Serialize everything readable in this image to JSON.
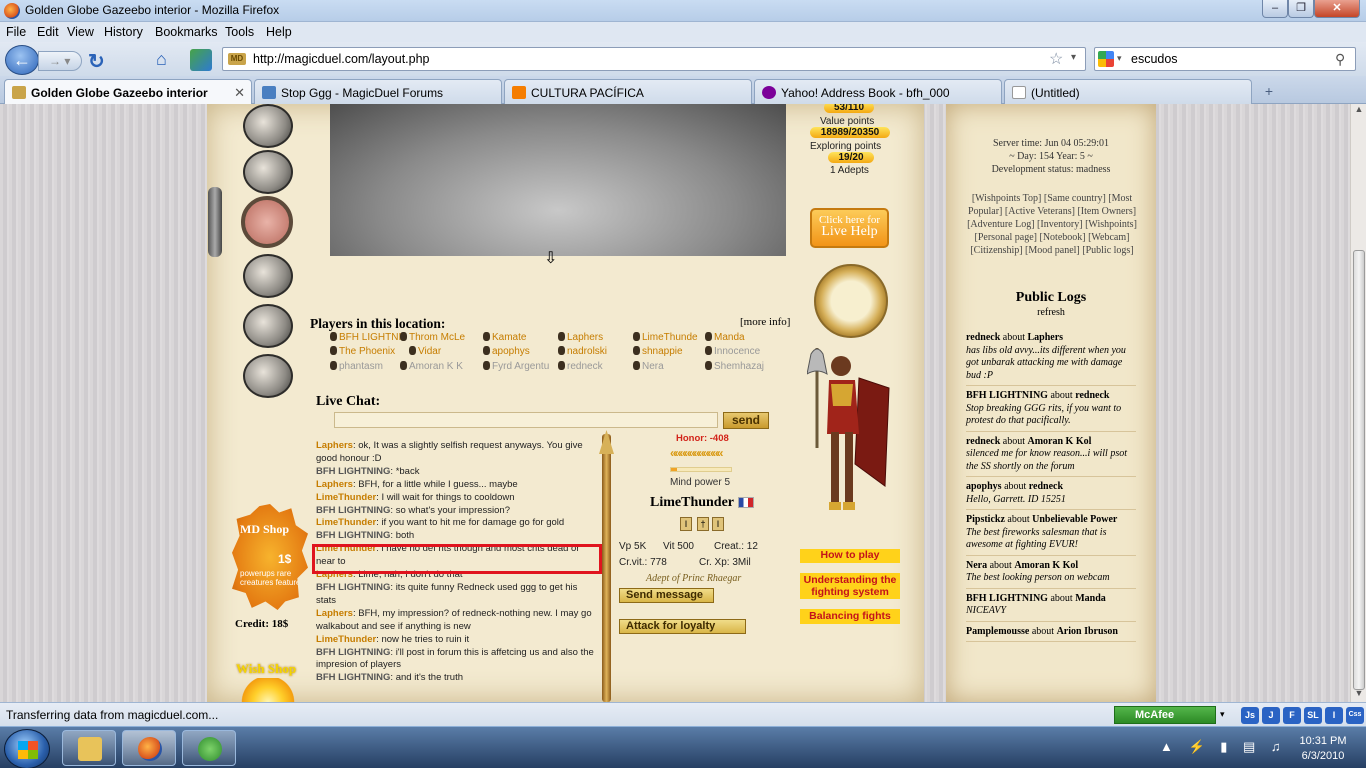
{
  "window": {
    "title": "Golden Globe Gazeebo interior - Mozilla Firefox",
    "minimize": "–",
    "maximize": "❐",
    "close": "✕"
  },
  "menu": [
    "File",
    "Edit",
    "View",
    "History",
    "Bookmarks",
    "Tools",
    "Help"
  ],
  "nav": {
    "url": "http://magicduel.com/layout.php",
    "search_value": "escudos",
    "fav_label": "MD"
  },
  "tabs": [
    {
      "label": "Golden Globe Gazeebo interior",
      "active": true,
      "color": "#c9a44a"
    },
    {
      "label": "Stop Ggg - MagicDuel Forums",
      "active": false,
      "color": "#4a7fc1"
    },
    {
      "label": "CULTURA PACÍFICA",
      "active": false,
      "color": "#f57d00"
    },
    {
      "label": "Yahoo! Address Book - bfh_000",
      "active": false,
      "color": "#7b0099"
    },
    {
      "label": "(Untitled)",
      "active": false,
      "color": "#ffffff"
    }
  ],
  "page": {
    "stats": {
      "top_value": "53/110",
      "value_points_label": "Value points",
      "value_points": "18989/20350",
      "exploring_label": "Exploring points",
      "exploring": "19/20",
      "adepts": "1  Adepts"
    },
    "live_help": {
      "line1": "Click here for",
      "line2": "Live Help"
    },
    "players_title": "Players in this location:",
    "more_info": "[more info]",
    "players": [
      {
        "name": "BFH LIGHTNI",
        "tone": "o"
      },
      {
        "name": "Throm McLe",
        "tone": "o"
      },
      {
        "name": "Kamate",
        "tone": "o"
      },
      {
        "name": "Laphers",
        "tone": "o"
      },
      {
        "name": "LimeThunde",
        "tone": "o"
      },
      {
        "name": "Manda",
        "tone": "o"
      },
      {
        "name": "The Phoenix",
        "tone": "o"
      },
      {
        "name": "Vidar",
        "tone": "o"
      },
      {
        "name": "apophys",
        "tone": "o"
      },
      {
        "name": "nadrolski",
        "tone": "o"
      },
      {
        "name": "shnappie",
        "tone": "o"
      },
      {
        "name": "Innocence",
        "tone": "g"
      },
      {
        "name": "phantasm",
        "tone": "g"
      },
      {
        "name": "Amoran K K",
        "tone": "g"
      },
      {
        "name": "Fyrd Argentu",
        "tone": "g"
      },
      {
        "name": "redneck",
        "tone": "g"
      },
      {
        "name": "Nera",
        "tone": "g"
      },
      {
        "name": "Shemhazaj",
        "tone": "g"
      }
    ],
    "livechat_label": "Live Chat:",
    "send_label": "send",
    "chat": [
      {
        "who": "Laphers",
        "tone": "o",
        "msg": ": ok, It was a slightly selfish request anyways. You give good honour :D"
      },
      {
        "who": "BFH LIGHTNING",
        "tone": "gr",
        "msg": ": *back"
      },
      {
        "who": "Laphers",
        "tone": "o",
        "msg": ": BFH, for a little while I guess... maybe"
      },
      {
        "who": "LimeThunder",
        "tone": "o",
        "msg": ": I will wait for things to cooldown"
      },
      {
        "who": "BFH LIGHTNING",
        "tone": "gr",
        "msg": ": so what's your impression?"
      },
      {
        "who": "LimeThunder",
        "tone": "o",
        "msg": ": if you want to hit me for damage go for gold"
      },
      {
        "who": "BFH LIGHTNING",
        "tone": "gr",
        "msg": ": both"
      },
      {
        "who": "LimeThunder",
        "tone": "o",
        "msg": ": i have no def rits though and most crits dead or near to"
      },
      {
        "who": "Laphers",
        "tone": "o",
        "msg": ": Lime, nah, I don't do that"
      },
      {
        "who": "BFH LIGHTNING",
        "tone": "gr",
        "msg": ": its quite funny Redneck used ggg to get his stats"
      },
      {
        "who": "Laphers",
        "tone": "o",
        "msg": ": BFH, my impression? of redneck-nothing new. I may go walkabout and see if anything is new"
      },
      {
        "who": "LimeThunder",
        "tone": "o",
        "msg": ": now he tries to ruin it"
      },
      {
        "who": "BFH LIGHTNING",
        "tone": "gr",
        "msg": ": i'll post in forum this is affetcing us and also the impresion of players"
      },
      {
        "who": "BFH LIGHTNING",
        "tone": "gr",
        "msg": ": and it's the truth"
      }
    ],
    "profile": {
      "honor": "Honor: -408",
      "arrows": "«««««««««««",
      "mind_fraction": 0.1,
      "mind": "Mind power 5",
      "name": "LimeThunder",
      "runes": [
        "I",
        "†",
        "I"
      ],
      "vp": "Vp 5K",
      "vit": "Vit 500",
      "creat": "Creat.: 12",
      "crvit": "Cr.vit.: 778",
      "crxp": "Cr. Xp: 3Mil",
      "adept": "Adept of Princ Rhaegar",
      "send_message": "Send message",
      "attack": "Attack for loyalty"
    },
    "orange_buttons": [
      "How to play",
      "Understanding the fighting system",
      "Balancing fights"
    ],
    "credit": "Credit: 18$",
    "md_shop": {
      "title": "MD Shop",
      "price": "1$",
      "desc": "powerups rare creatures features"
    },
    "wish_shop": "Wish Shop",
    "server": [
      "Server time: Jun 04 05:29:01",
      "~ Day: 154 Year: 5 ~",
      "Development status: madness"
    ],
    "links": "[Wishpoints Top] [Same country] [Most Popular] [Active Veterans] [Item Owners] [Adventure Log] [Inventory] [Wishpoints] [Personal page] [Notebook] [Webcam] [Citizenship] [Mood panel] [Public logs]",
    "logs_title": "Public Logs",
    "logs_refresh": "refresh",
    "logs": [
      {
        "a": "redneck",
        "b": "Laphers",
        "text": "has libs old avvy...its different when you got unbarak attacking me with damage bud :P"
      },
      {
        "a": "BFH LIGHTNING",
        "b": "redneck",
        "text": "Stop breaking GGG rits, if you want to protest do that pacifically."
      },
      {
        "a": "redneck",
        "b": "Amoran K Kol",
        "text": "silenced me for know reason...i will psot the SS shortly on the forum"
      },
      {
        "a": "apophys",
        "b": "redneck",
        "text": "Hello, Garrett. ID 15251"
      },
      {
        "a": "Pipstickz",
        "b": "Unbelievable Power",
        "text": "The best fireworks salesman that is awesome at fighting EVUR!"
      },
      {
        "a": "Nera",
        "b": "Amoran K Kol",
        "text": "The best looking person on webcam"
      },
      {
        "a": "BFH LIGHTNING",
        "b": "Manda",
        "text": "NICEAVY"
      },
      {
        "a": "Pamplemousse",
        "b": "Arion Ibruson",
        "text": ""
      }
    ],
    "about_word": "about"
  },
  "status": {
    "text": "Transferring data from magicduel.com...",
    "mcafee": "McAfee",
    "buttons": [
      "Js",
      "J",
      "F",
      "SL",
      "I",
      "Css"
    ]
  },
  "taskbar": {
    "time": "10:31 PM",
    "date": "6/3/2010"
  },
  "colors": {
    "orange_text": "#c67d00",
    "highlight_box": "#e0141e",
    "honor": "#d2241a"
  }
}
